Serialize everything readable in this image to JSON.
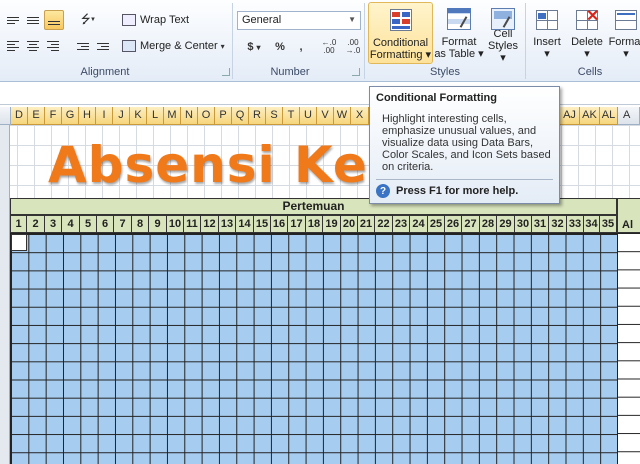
{
  "ribbon": {
    "alignment": {
      "label": "Alignment",
      "wrap_text": "Wrap Text",
      "merge_center": "Merge & Center"
    },
    "number": {
      "label": "Number",
      "format_value": "General",
      "currency_symbol": "$",
      "percent_symbol": "%",
      "comma_symbol": ",",
      "increase_decimal": "←.0 .00",
      "decrease_decimal": ".00 →.0"
    },
    "styles": {
      "label": "Styles",
      "conditional_formatting_line1": "Conditional",
      "conditional_formatting_line2": "Formatting ▾",
      "format_as_table_line1": "Format",
      "format_as_table_line2": "as Table ▾",
      "cell_styles_line1": "Cell",
      "cell_styles_line2": "Styles ▾"
    },
    "cells": {
      "label": "Cells",
      "insert": "Insert",
      "delete": "Delete",
      "format": "Format"
    }
  },
  "columns_left": [
    "D",
    "E",
    "F",
    "G",
    "H",
    "I",
    "J",
    "K",
    "L",
    "M",
    "N",
    "O",
    "P",
    "Q",
    "R",
    "S",
    "T",
    "U",
    "V",
    "W",
    "X"
  ],
  "columns_right": [
    "AJ",
    "AK",
    "AL"
  ],
  "column_partial": "A",
  "sheet": {
    "title": "Absensi Kelas",
    "pertemuan": "Pertemuan",
    "meeting_numbers": [
      "1",
      "2",
      "3",
      "4",
      "5",
      "6",
      "7",
      "8",
      "9",
      "10",
      "11",
      "12",
      "13",
      "14",
      "15",
      "16",
      "17",
      "18",
      "19",
      "20",
      "21",
      "22",
      "23",
      "24",
      "25",
      "26",
      "27",
      "28",
      "29",
      "30",
      "31",
      "32",
      "33",
      "34",
      "35"
    ],
    "right_header": "Al"
  },
  "tooltip": {
    "title": "Conditional Formatting",
    "body": "Highlight interesting cells, emphasize unusual values, and visualize data using Data Bars, Color Scales, and Icon Sets based on criteria.",
    "help": "Press F1 for more help."
  },
  "colors": {
    "title_orange": "#f07a1a",
    "header_green": "#d8e4bc",
    "grid_blue": "#a6ccef"
  }
}
